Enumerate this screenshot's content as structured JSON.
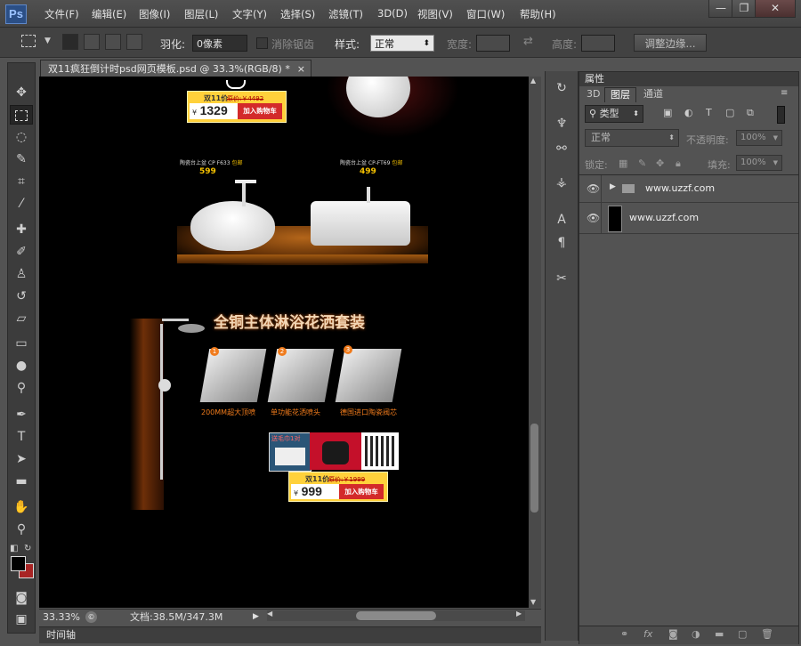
{
  "app": {
    "logo": "Ps"
  },
  "menu": [
    "文件(F)",
    "编辑(E)",
    "图像(I)",
    "图层(L)",
    "文字(Y)",
    "选择(S)",
    "滤镜(T)",
    "3D(D)",
    "视图(V)",
    "窗口(W)",
    "帮助(H)"
  ],
  "window_controls": {
    "minimize": "—",
    "restore": "❐",
    "close": "✕"
  },
  "options": {
    "feather_label": "羽化:",
    "feather_value": "0像素",
    "antialias_label": "消除锯齿",
    "style_label": "样式:",
    "style_value": "正常",
    "width_label": "宽度:",
    "height_label": "高度:",
    "refine_edge_button": "调整边缘..."
  },
  "document": {
    "tab_title": "双11疯狂倒计时psd网页模板.psd @ 33.3%(RGB/8) *",
    "zoom": "33.33%",
    "doc_size": "文档:38.5M/347.3M",
    "timeline_label": "时间轴"
  },
  "artwork": {
    "top_price": {
      "prefix": "双11价",
      "original": "原价:￥4492",
      "currency": "¥",
      "price": "1329",
      "button": "加入购物车"
    },
    "products": [
      {
        "name": "陶瓷台上盆 CP F633",
        "tag": "包邮",
        "price": "599"
      },
      {
        "name": "陶瓷台上盆 CP-FT69",
        "tag": "包邮",
        "price": "499"
      }
    ],
    "shower_title": "全铜主体淋浴花洒套装",
    "features": [
      {
        "num": "1",
        "label": "200MM超大顶喷"
      },
      {
        "num": "2",
        "label": "单功能花洒喷头"
      },
      {
        "num": "3",
        "label": "德国进口陶瓷阀芯"
      }
    ],
    "promo_gift": "送毛巾1对",
    "bottom_price": {
      "prefix": "双11价",
      "original": "原价:￥1999",
      "currency": "¥",
      "price": "999",
      "button": "加入购物车"
    }
  },
  "panel": {
    "properties_title": "属性",
    "tabs": [
      "3D",
      "图层",
      "通道"
    ],
    "filter_kind": "类型",
    "blend_mode": "正常",
    "opacity_label": "不透明度:",
    "opacity_value": "100%",
    "lock_label": "锁定:",
    "fill_label": "填充:",
    "fill_value": "100%",
    "layers": [
      {
        "name": "www.uzzf.com",
        "type": "group"
      },
      {
        "name": "www.uzzf.com",
        "type": "layer"
      }
    ]
  },
  "colors": {
    "accent_price": "#ffd13b",
    "buy_red": "#d32a2a",
    "foreground": "#000000",
    "background": "#a82424"
  }
}
